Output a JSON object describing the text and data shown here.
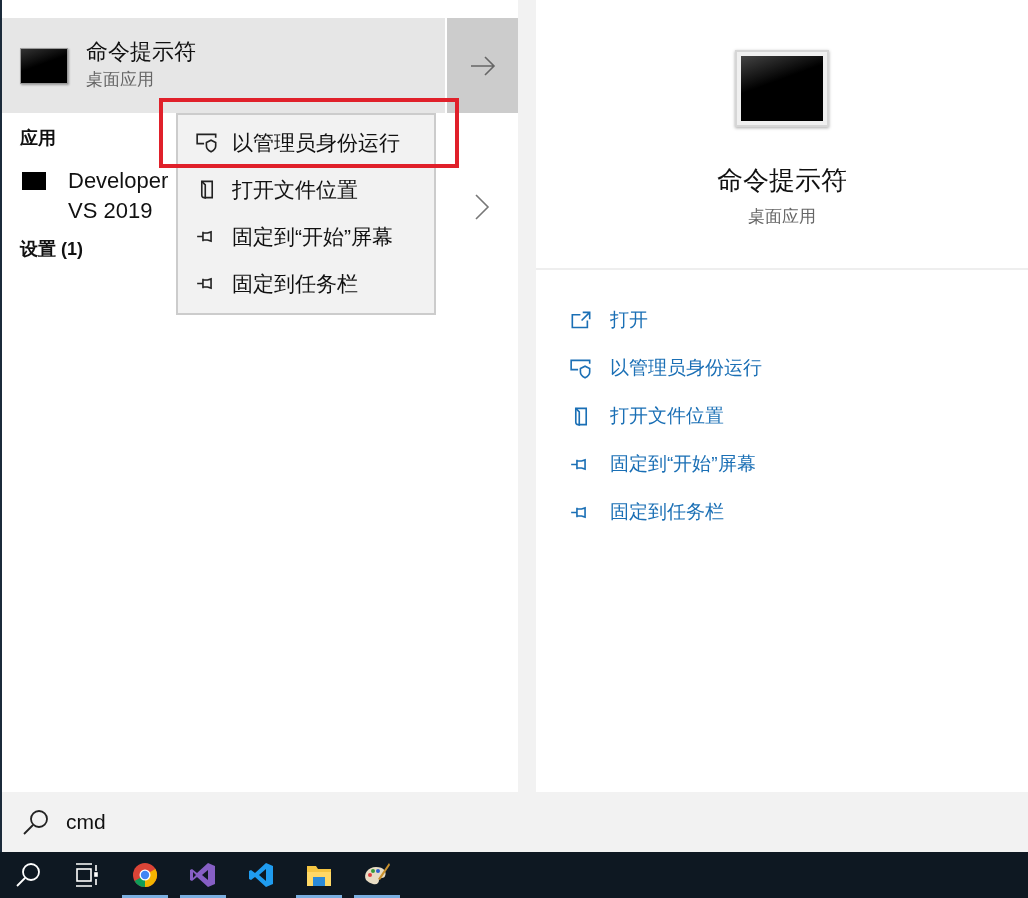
{
  "best_match": {
    "title": "命令提示符",
    "subtitle": "桌面应用",
    "selected": true
  },
  "context_menu": {
    "items": [
      {
        "kind": "shield",
        "label": "以管理员身份运行",
        "highlighted": true
      },
      {
        "kind": "file",
        "label": "打开文件位置",
        "highlighted": false
      },
      {
        "kind": "pin",
        "label": "固定到“开始”屏幕",
        "highlighted": false
      },
      {
        "kind": "pin",
        "label": "固定到任务栏",
        "highlighted": false
      }
    ]
  },
  "apps_heading": "应用",
  "apps": [
    {
      "title": "Developer\nVS 2019"
    }
  ],
  "settings_heading": "设置 (1)",
  "preview": {
    "title": "命令提示符",
    "subtitle": "桌面应用",
    "actions": [
      {
        "kind": "open",
        "label": "打开"
      },
      {
        "kind": "shield",
        "label": "以管理员身份运行"
      },
      {
        "kind": "file",
        "label": "打开文件位置"
      },
      {
        "kind": "pin",
        "label": "固定到“开始”屏幕"
      },
      {
        "kind": "pin",
        "label": "固定到任务栏"
      }
    ]
  },
  "search": {
    "value": "cmd"
  },
  "taskbar": {
    "items": [
      {
        "kind": "search",
        "running": false
      },
      {
        "kind": "task_view",
        "running": false
      },
      {
        "kind": "browser",
        "running": true
      },
      {
        "kind": "ide",
        "running": true
      },
      {
        "kind": "code_editor",
        "running": false
      },
      {
        "kind": "folder",
        "running": true
      },
      {
        "kind": "palette",
        "running": true
      }
    ]
  }
}
